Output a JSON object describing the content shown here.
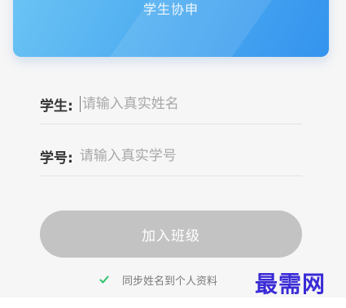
{
  "header": {
    "title": "学生协申"
  },
  "form": {
    "student": {
      "label": "学生:",
      "placeholder": "请输入真实姓名"
    },
    "student_id": {
      "label": "学号:",
      "placeholder": "请输入真实学号"
    }
  },
  "join_button": {
    "label": "加入班级"
  },
  "sync": {
    "label": "同步姓名到个人资料",
    "checked": true
  },
  "watermark": {
    "text": "最需网"
  },
  "colors": {
    "header_gradient_start": "#6cc4f4",
    "header_gradient_end": "#3493ee",
    "button_disabled": "#c3c3c3",
    "check_green": "#2ec26a",
    "watermark": "#3a2bd6"
  }
}
